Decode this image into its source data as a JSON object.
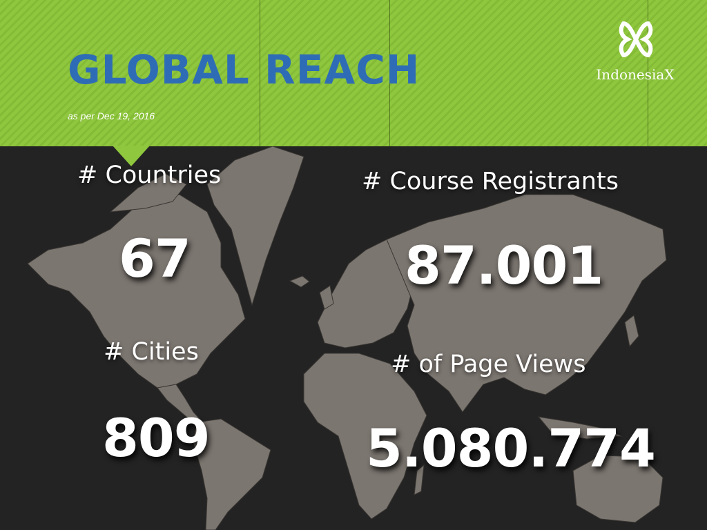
{
  "header": {
    "title": "GLOBAL REACH",
    "date_note": "as per Dec 19, 2016",
    "accent_color": "#8fc73e",
    "title_color": "#2e6db6"
  },
  "logo": {
    "icon": "indonesiax-knot-icon",
    "text": "IndonesiaX"
  },
  "stats": {
    "countries": {
      "label": "# Countries",
      "value": "67"
    },
    "registrants": {
      "label": "# Course Registrants",
      "value": "87.001"
    },
    "cities": {
      "label": "# Cities",
      "value": "809"
    },
    "page_views": {
      "label": "# of Page Views",
      "value": "5.080.774"
    }
  },
  "background": {
    "image": "world-map",
    "color": "#232323"
  }
}
